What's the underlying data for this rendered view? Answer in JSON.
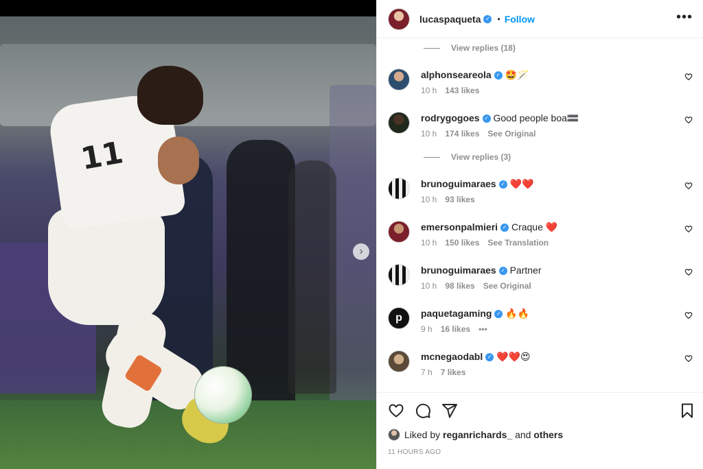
{
  "post": {
    "author": "lucaspaqueta",
    "follow_label": "Follow",
    "separator": "•",
    "more_label": "•••"
  },
  "comments": [
    {
      "type": "replies",
      "label": "View replies (18)"
    },
    {
      "type": "comment",
      "username": "alphonseareola",
      "text": "🤩🪄",
      "time": "10 h",
      "likes": "143 likes",
      "extra": ""
    },
    {
      "type": "comment",
      "username": "rodrygogoes",
      "text": "Good people boa🟰",
      "time": "10 h",
      "likes": "174 likes",
      "extra": "See Original"
    },
    {
      "type": "replies",
      "label": "View replies (3)"
    },
    {
      "type": "comment",
      "username": "brunoguimaraes",
      "text": "❤️❤️",
      "time": "10 h",
      "likes": "93 likes",
      "extra": ""
    },
    {
      "type": "comment",
      "username": "emersonpalmieri",
      "text": "Craque ❤️",
      "time": "10 h",
      "likes": "150 likes",
      "extra": "See Translation"
    },
    {
      "type": "comment",
      "username": "brunoguimaraes",
      "text": "Partner",
      "time": "10 h",
      "likes": "98 likes",
      "extra": "See Original"
    },
    {
      "type": "comment",
      "username": "paquetagaming",
      "text": "🔥🔥",
      "time": "9 h",
      "likes": "16 likes",
      "extra": "•••"
    },
    {
      "type": "comment",
      "username": "mcnegaodabl",
      "text": "❤️❤️😍",
      "time": "7 h",
      "likes": "7 likes",
      "extra": ""
    }
  ],
  "liked_by": {
    "prefix": "Liked by",
    "user": "reganrichards_",
    "joiner": "and",
    "others": "others"
  },
  "timestamp": "11 HOURS AGO",
  "photo": {
    "shirt_number": "11",
    "next_arrow": "›"
  },
  "verified_mark": "✓",
  "colors": {
    "accent": "#0095f6",
    "verified": "#3897f0",
    "muted": "#8e8e8e",
    "text": "#262626"
  },
  "icons": [
    "heart-icon",
    "comment-icon",
    "share-icon",
    "bookmark-icon",
    "more-icon",
    "chevron-right-icon",
    "verified-icon"
  ]
}
